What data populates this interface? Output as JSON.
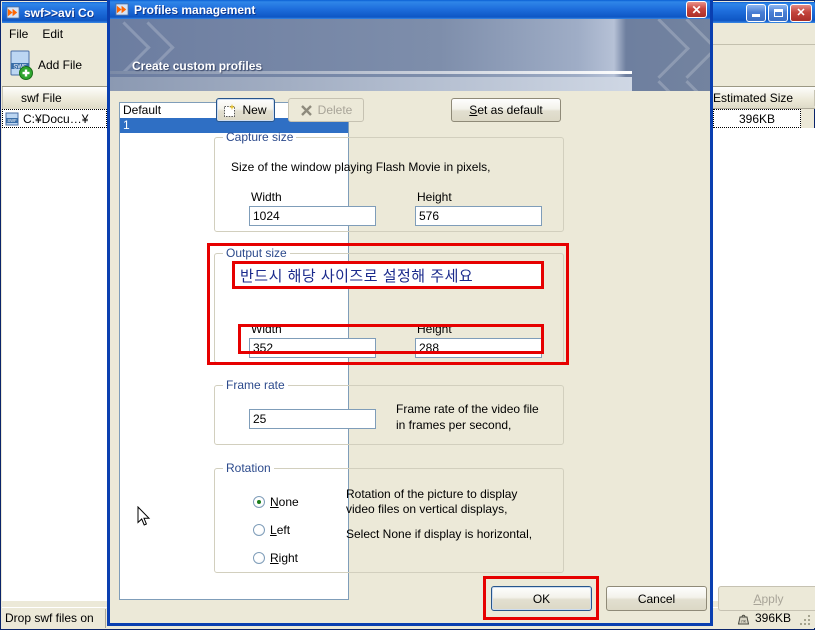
{
  "background_window": {
    "title": "swf>>avi Co",
    "menu": [
      {
        "label": "File"
      },
      {
        "label": "Edit"
      }
    ],
    "toolbar": {
      "add_file_label": "Add File",
      "add_file_icon": "swf-document-add-icon"
    },
    "list": {
      "column_left": "swf File",
      "column_right": "Estimated Size",
      "rows": [
        {
          "file": "C:¥Docu…¥",
          "size": "396KB"
        }
      ]
    },
    "status_bar": {
      "hint": "Drop swf files on",
      "size_icon": "weight-icon",
      "size_value": "396KB"
    },
    "window_controls": {
      "minimize": "minimize-icon",
      "maximize": "maximize-icon",
      "close": "close-icon"
    }
  },
  "dialog": {
    "title": "Profiles management",
    "title_icon": "swf-app-icon",
    "close_label": "✕",
    "banner_text": "Create custom profiles",
    "profiles": {
      "items": [
        {
          "label": "Default",
          "selected": false
        },
        {
          "label": "1",
          "selected": true
        }
      ]
    },
    "buttons": {
      "new": {
        "label": "New",
        "icon": "new-profile-icon",
        "enabled": true
      },
      "delete": {
        "label": "Delete",
        "icon": "delete-x-icon",
        "enabled": false
      },
      "set_default": {
        "label": "Set  as default",
        "accel": "S",
        "enabled": true
      }
    },
    "capture_size": {
      "legend": "Capture size",
      "description": "Size of the window playing Flash Movie in pixels,",
      "width_label": "Width",
      "width_value": "1024",
      "height_label": "Height",
      "height_value": "576"
    },
    "output_size": {
      "legend": "Output size",
      "note": "반드시 해당 사이즈로 설정해 주세요",
      "width_label": "Width",
      "width_value": "352",
      "height_label": "Height",
      "height_value": "288",
      "highlight_color": "#e60000"
    },
    "frame_rate": {
      "legend": "Frame rate",
      "value": "25",
      "description_line1": "Frame rate of the video file",
      "description_line2": "in frames per second,"
    },
    "rotation": {
      "legend": "Rotation",
      "options": [
        {
          "label": "None",
          "selected": true
        },
        {
          "label": "Left",
          "selected": false
        },
        {
          "label": "Right",
          "selected": false
        }
      ],
      "description_line1": "Rotation of the picture to display",
      "description_line2": "video files on vertical displays,",
      "description_line3": "Select None if display is horizontal,"
    },
    "footer": {
      "ok": "OK",
      "cancel": "Cancel",
      "apply": "Apply",
      "apply_enabled": false
    }
  },
  "colors": {
    "dialog_face": "#ece9d8",
    "titlebar_blue": "#0b5fd4",
    "group_legend": "#2c4a8c",
    "highlight_red": "#e60000",
    "selection_blue": "#2f6fc4",
    "korean_text": "#1a2a8c"
  }
}
